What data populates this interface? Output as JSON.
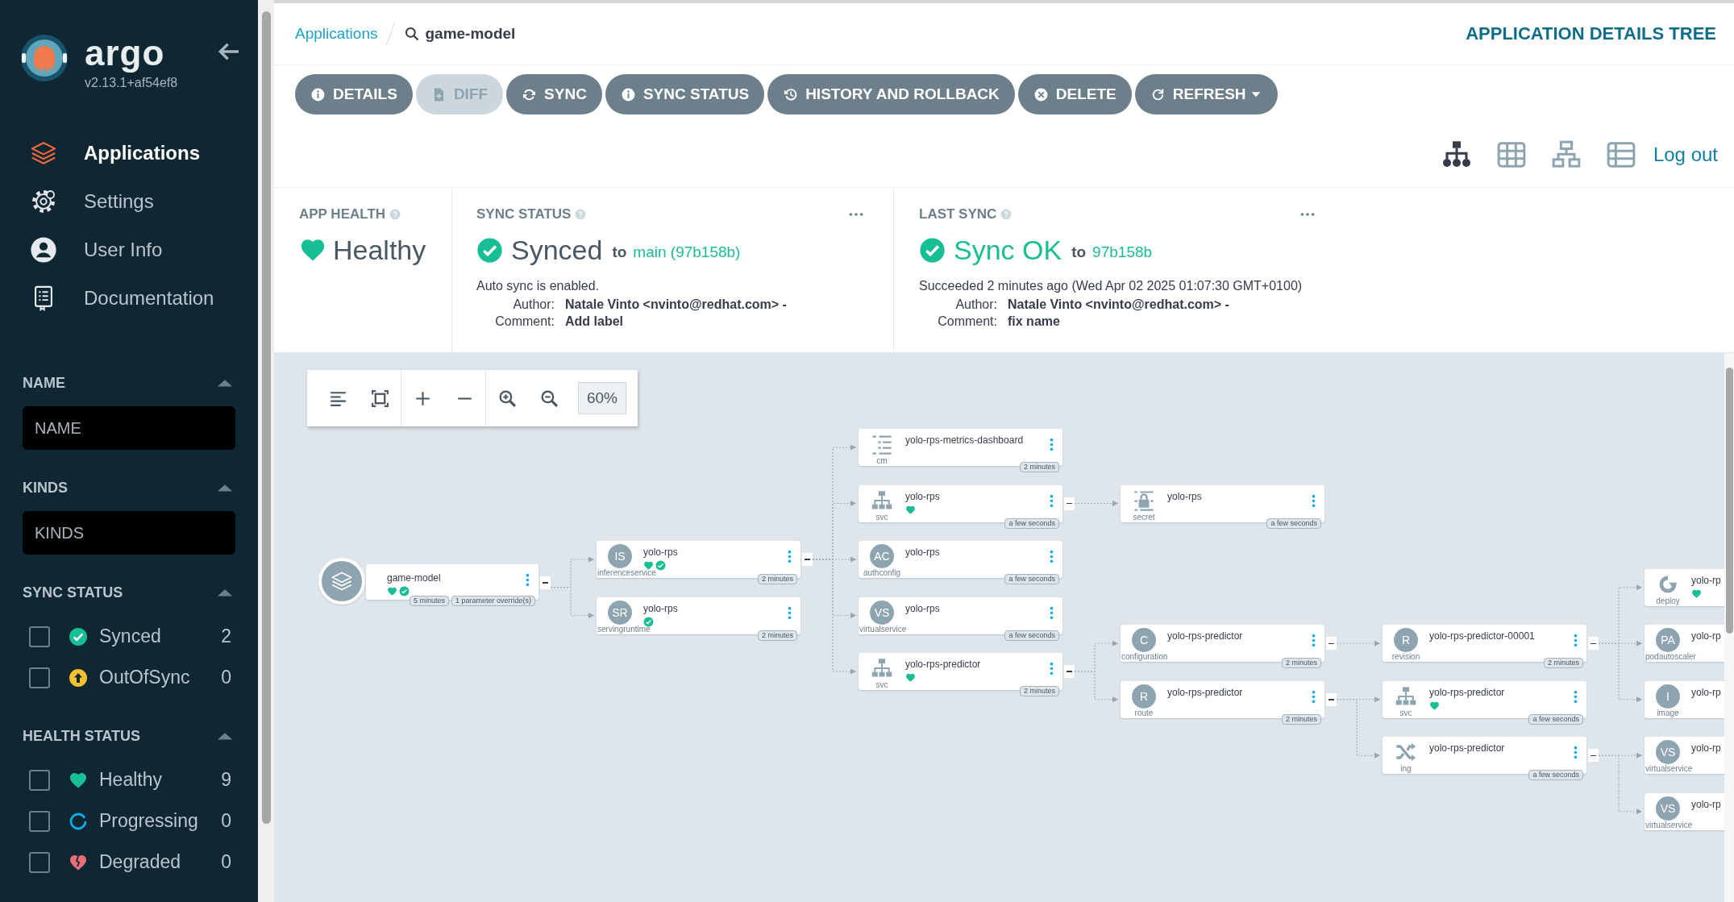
{
  "sidebar": {
    "logo": {
      "title": "argo",
      "version": "v2.13.1+af54ef8"
    },
    "nav": [
      {
        "label": "Applications",
        "selected": true
      },
      {
        "label": "Settings",
        "selected": false
      },
      {
        "label": "User Info",
        "selected": false
      },
      {
        "label": "Documentation",
        "selected": false
      }
    ],
    "filters": [
      {
        "title": "NAME",
        "kind": "text",
        "expanded": true,
        "placeholder": "NAME"
      },
      {
        "title": "KINDS",
        "kind": "text",
        "expanded": true,
        "placeholder": "KINDS"
      },
      {
        "title": "SYNC STATUS",
        "kind": "checklist",
        "expanded": true,
        "options": [
          {
            "label": "Synced",
            "kind": "synced",
            "count": "2",
            "checked": false
          },
          {
            "label": "OutOfSync",
            "kind": "outofsync",
            "count": "0",
            "checked": false
          }
        ]
      },
      {
        "title": "HEALTH STATUS",
        "kind": "checklist",
        "expanded": true,
        "options": [
          {
            "label": "Healthy",
            "kind": "healthy",
            "count": "9",
            "checked": false
          },
          {
            "label": "Progressing",
            "kind": "progressing",
            "count": "0",
            "checked": false
          },
          {
            "label": "Degraded",
            "kind": "degraded",
            "count": "0",
            "checked": false
          }
        ]
      }
    ]
  },
  "breadcrumbs": [
    {
      "label": "Applications",
      "kind": "link"
    },
    {
      "label": "game-model",
      "kind": "search"
    }
  ],
  "page_title": "APPLICATION DETAILS TREE",
  "actions": [
    {
      "label": "DETAILS",
      "disabled": false
    },
    {
      "label": "DIFF",
      "disabled": true
    },
    {
      "label": "SYNC",
      "disabled": false
    },
    {
      "label": "SYNC STATUS",
      "disabled": false
    },
    {
      "label": "HISTORY AND ROLLBACK",
      "disabled": false
    },
    {
      "label": "DELETE",
      "disabled": false
    },
    {
      "label": "REFRESH",
      "disabled": false,
      "dropdown": true
    }
  ],
  "view_modes": [
    {
      "selected": true
    },
    {
      "selected": false
    },
    {
      "selected": false
    },
    {
      "selected": false
    }
  ],
  "logout": "Log out",
  "summary": {
    "app_health": {
      "title": "APP HEALTH",
      "status": "Healthy"
    },
    "sync_status": {
      "title": "SYNC STATUS",
      "status": "Synced",
      "to_label": "to",
      "revision": "main (97b158b)",
      "message": "Auto sync is enabled.",
      "author_label": "Author:",
      "author": "Natale Vinto <nvinto@redhat.com> -",
      "comment_label": "Comment:",
      "comment": "Add label"
    },
    "last_sync": {
      "title": "LAST SYNC",
      "status": "Sync OK",
      "to_label": "to",
      "revision": "97b158b",
      "message": "Succeeded 2 minutes ago (Wed Apr 02 2025 01:07:30 GMT+0100)",
      "author_label": "Author:",
      "author": "Natale Vinto <nvinto@redhat.com> -",
      "comment_label": "Comment:",
      "comment": "fix name"
    }
  },
  "graph": {
    "zoom": "60%",
    "root": {
      "name": "game-model",
      "kind": "app",
      "healthy": true,
      "synced": true,
      "menu": true,
      "badges": [
        "5 minutes",
        "1 parameter override(s)"
      ],
      "children": [
        {
          "name": "yolo-rps",
          "kind": "initials",
          "initials": "IS",
          "resource": "inferenceservice",
          "healthy": true,
          "synced": true,
          "menu": true,
          "badges": [
            "2 minutes"
          ],
          "children": [
            {
              "name": "yolo-rps-metrics-dashboard",
              "kind": "list",
              "resource": "cm",
              "healthy": false,
              "synced": false,
              "menu": true,
              "badges": [
                "2 minutes"
              ]
            },
            {
              "name": "yolo-rps",
              "kind": "network",
              "resource": "svc",
              "healthy": true,
              "synced": false,
              "menu": true,
              "badges": [
                "a few seconds"
              ],
              "children": [
                {
                  "name": "yolo-rps",
                  "kind": "lock",
                  "resource": "secret",
                  "healthy": false,
                  "synced": false,
                  "menu": true,
                  "badges": [
                    "a few seconds"
                  ]
                }
              ]
            },
            {
              "name": "yolo-rps",
              "kind": "initials",
              "initials": "AC",
              "resource": "authconfig",
              "healthy": false,
              "synced": false,
              "menu": true,
              "badges": [
                "a few seconds"
              ]
            },
            {
              "name": "yolo-rps",
              "kind": "initials",
              "initials": "VS",
              "resource": "virtualservice",
              "healthy": false,
              "synced": false,
              "menu": true,
              "badges": [
                "a few seconds"
              ]
            },
            {
              "name": "yolo-rps-predictor",
              "kind": "network",
              "resource": "svc",
              "healthy": true,
              "synced": false,
              "menu": true,
              "badges": [
                "2 minutes"
              ],
              "children": [
                {
                  "name": "yolo-rps-predictor",
                  "kind": "initials",
                  "initials": "C",
                  "resource": "configuration",
                  "healthy": false,
                  "synced": false,
                  "menu": true,
                  "badges": [
                    "2 minutes"
                  ],
                  "children": [
                    {
                      "name": "yolo-rps-predictor-00001",
                      "kind": "initials",
                      "initials": "R",
                      "resource": "revision",
                      "healthy": false,
                      "synced": false,
                      "menu": true,
                      "badges": [
                        "2 minutes"
                      ],
                      "children": [
                        {
                          "name": "yolo-rp",
                          "kind": "cycle",
                          "resource": "deploy",
                          "healthy": true,
                          "synced": false,
                          "menu": false
                        },
                        {
                          "name": "yolo-rp",
                          "kind": "initials",
                          "initials": "PA",
                          "resource": "podautoscaler",
                          "healthy": false,
                          "synced": false,
                          "menu": false
                        },
                        {
                          "name": "yolo-rp",
                          "kind": "initials",
                          "initials": "I",
                          "resource": "image",
                          "healthy": false,
                          "synced": false,
                          "menu": false
                        }
                      ]
                    }
                  ]
                },
                {
                  "name": "yolo-rps-predictor",
                  "kind": "initials",
                  "initials": "R",
                  "resource": "route",
                  "healthy": false,
                  "synced": false,
                  "menu": true,
                  "badges": [
                    "2 minutes"
                  ],
                  "children": [
                    {
                      "name": "yolo-rps-predictor",
                      "kind": "network",
                      "resource": "svc",
                      "healthy": true,
                      "synced": false,
                      "menu": true,
                      "badges": [
                        "a few seconds"
                      ]
                    },
                    {
                      "name": "yolo-rps-predictor",
                      "kind": "shuffle",
                      "resource": "ing",
                      "healthy": false,
                      "synced": false,
                      "menu": true,
                      "badges": [
                        "a few seconds"
                      ],
                      "children": [
                        {
                          "name": "yolo-rp",
                          "kind": "initials",
                          "initials": "VS",
                          "resource": "virtualservice",
                          "healthy": false,
                          "synced": false,
                          "menu": false
                        },
                        {
                          "name": "yolo-rp",
                          "kind": "initials",
                          "initials": "VS",
                          "resource": "virtualservice",
                          "healthy": false,
                          "synced": false,
                          "menu": false
                        }
                      ]
                    }
                  ]
                }
              ]
            }
          ]
        },
        {
          "name": "yolo-rps",
          "kind": "initials",
          "initials": "SR",
          "resource": "servingruntime",
          "healthy": false,
          "synced": true,
          "menu": true,
          "badges": [
            "2 minutes"
          ]
        }
      ]
    }
  }
}
